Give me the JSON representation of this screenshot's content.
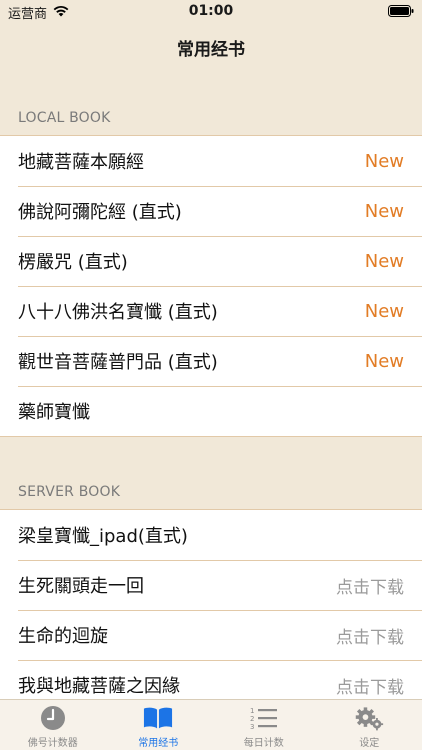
{
  "status": {
    "carrier": "运营商",
    "time": "01:00"
  },
  "nav": {
    "title": "常用经书"
  },
  "local_section": {
    "header": "LOCAL BOOK",
    "items": [
      {
        "label": "地藏菩薩本願經",
        "badge": "New"
      },
      {
        "label": "佛說阿彌陀經 (直式)",
        "badge": "New"
      },
      {
        "label": "楞嚴咒 (直式)",
        "badge": "New"
      },
      {
        "label": "八十八佛洪名寶懺 (直式)",
        "badge": "New"
      },
      {
        "label": "觀世音菩薩普門品 (直式)",
        "badge": "New"
      },
      {
        "label": "藥師寶懺",
        "badge": ""
      }
    ]
  },
  "server_section": {
    "header": "SERVER BOOK",
    "items": [
      {
        "label": "梁皇寶懺_ipad(直式)",
        "action": ""
      },
      {
        "label": "生死關頭走一回",
        "action": "点击下载"
      },
      {
        "label": "生命的迴旋",
        "action": "点击下载"
      },
      {
        "label": "我與地藏菩薩之因緣",
        "action": "点击下载"
      }
    ]
  },
  "tabs": [
    {
      "label": "佛号计数器",
      "icon": "clock-icon",
      "active": false
    },
    {
      "label": "常用经书",
      "icon": "book-icon",
      "active": true
    },
    {
      "label": "每日计数",
      "icon": "numbered-list-icon",
      "active": false
    },
    {
      "label": "设定",
      "icon": "gear-icon",
      "active": false
    }
  ],
  "colors": {
    "background": "#f1e8d8",
    "badge_new": "#e27c25",
    "active_tab": "#1c74e6",
    "separator": "#e2c9a8"
  }
}
